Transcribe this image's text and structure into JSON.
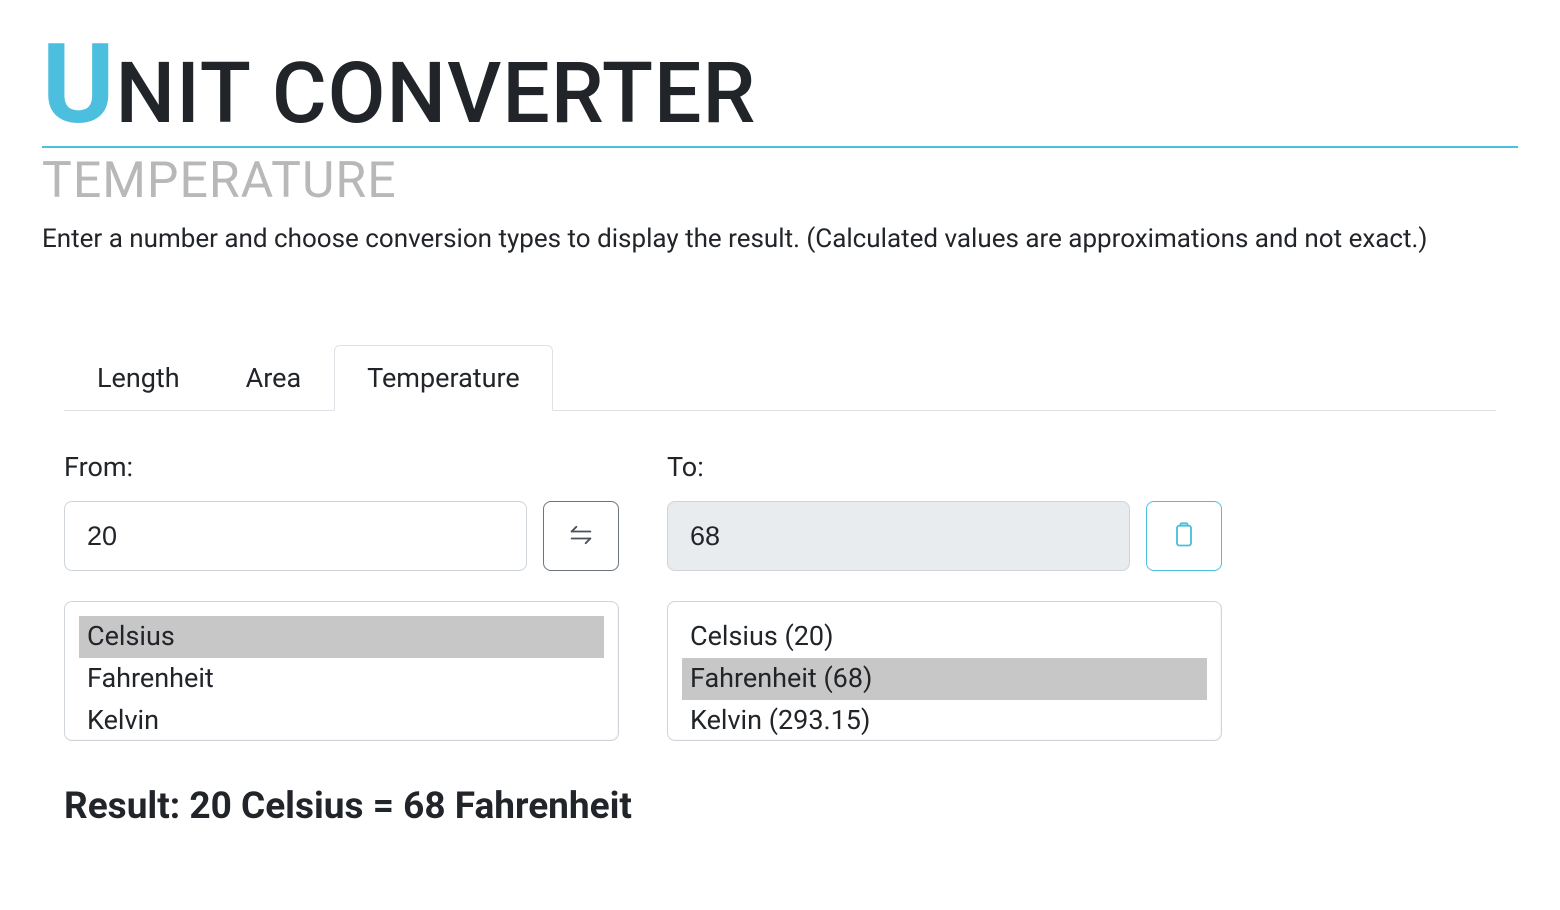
{
  "header": {
    "title_first": "U",
    "title_rest": "NIT CONVERTER",
    "subtitle": "TEMPERATURE",
    "description": "Enter a number and choose conversion types to display the result. (Calculated values are approximations and not exact.)"
  },
  "tabs": [
    {
      "label": "Length",
      "active": false
    },
    {
      "label": "Area",
      "active": false
    },
    {
      "label": "Temperature",
      "active": true
    }
  ],
  "from": {
    "label": "From:",
    "value": "20",
    "options": [
      {
        "label": "Celsius",
        "selected": true
      },
      {
        "label": "Fahrenheit",
        "selected": false
      },
      {
        "label": "Kelvin",
        "selected": false
      }
    ]
  },
  "to": {
    "label": "To:",
    "value": "68",
    "options": [
      {
        "label": "Celsius (20)",
        "selected": false
      },
      {
        "label": "Fahrenheit (68)",
        "selected": true
      },
      {
        "label": "Kelvin (293.15)",
        "selected": false
      }
    ]
  },
  "result": "Result: 20 Celsius = 68 Fahrenheit"
}
